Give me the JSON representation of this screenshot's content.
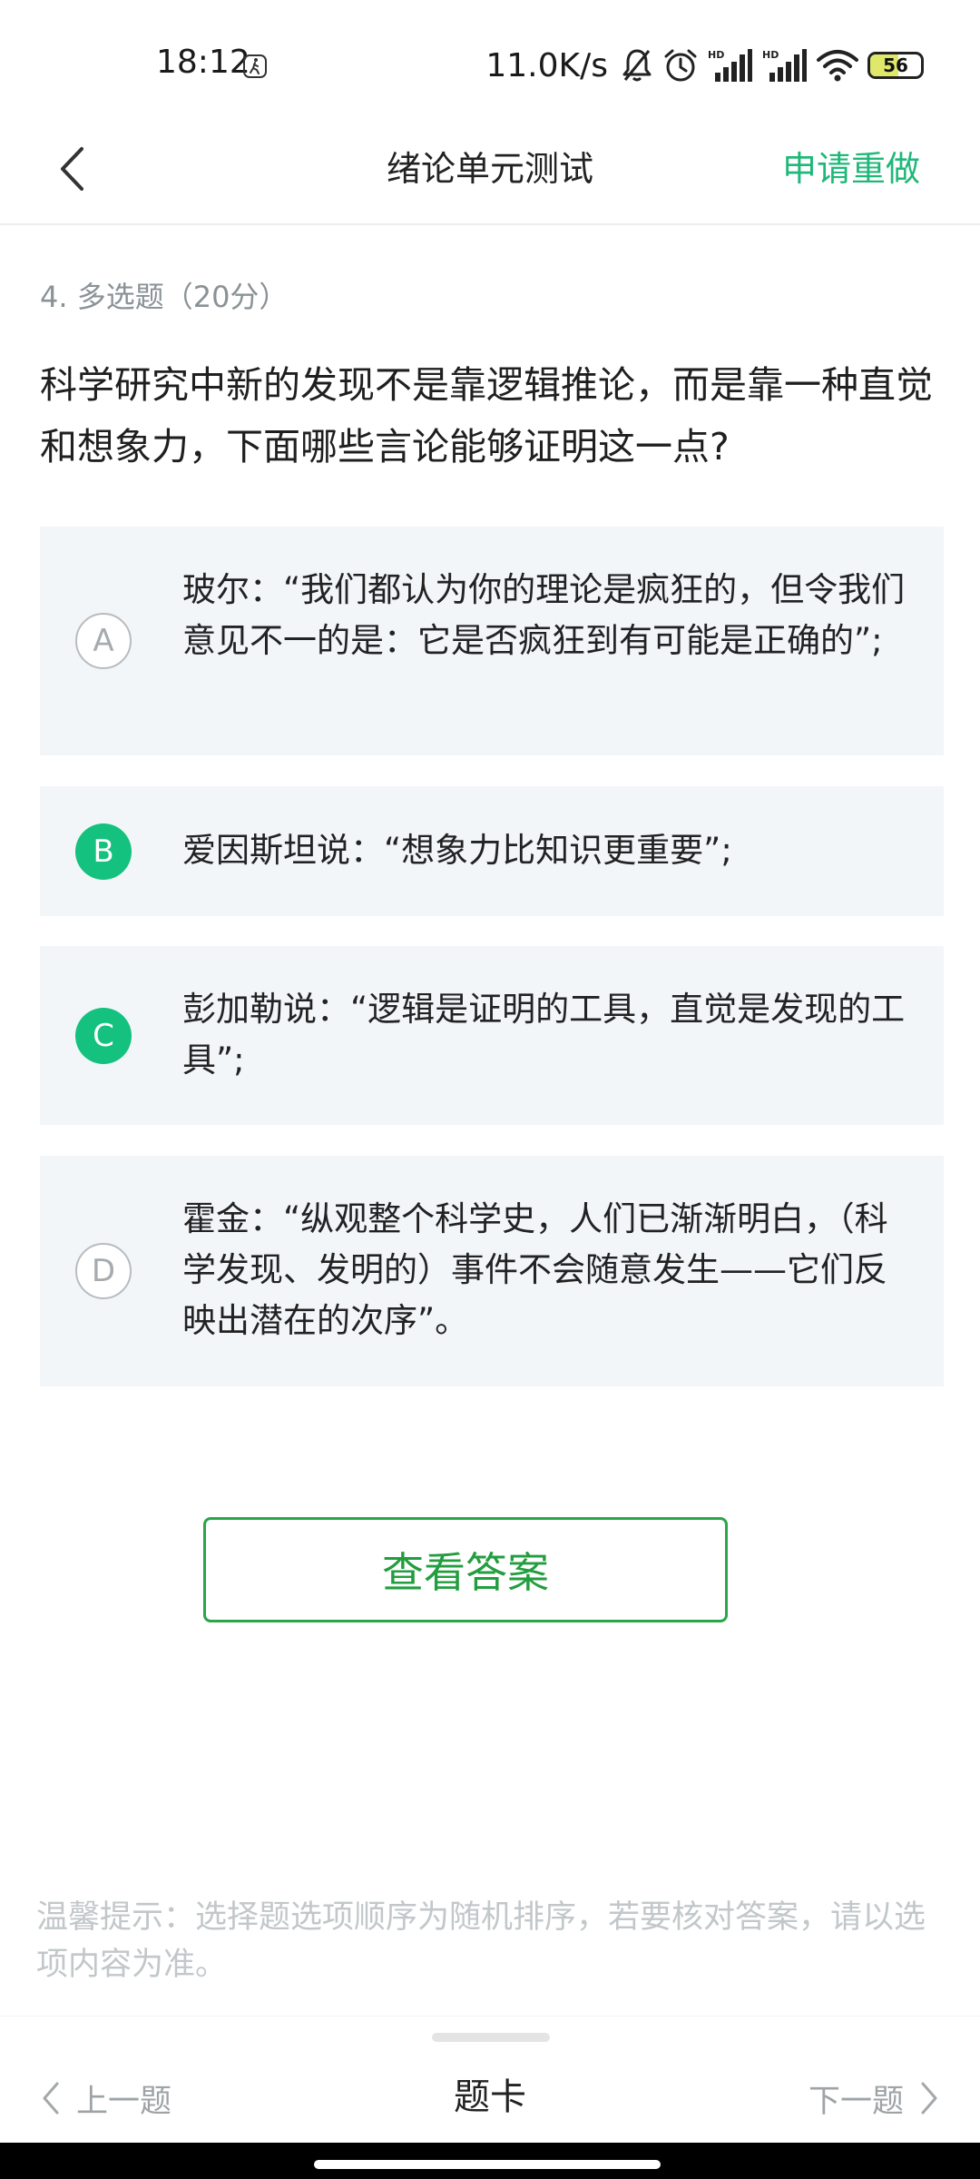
{
  "status_bar": {
    "time": "18:12",
    "network_speed": "11.0K/s",
    "battery_level": "56",
    "battery_percent": 56,
    "icons": [
      "walk-icon",
      "mute-bell-icon",
      "alarm-icon",
      "hd-signal-icon",
      "hd-signal-icon",
      "wifi-icon",
      "battery-icon"
    ],
    "hd_label": "HD"
  },
  "header": {
    "title": "绪论单元测试",
    "redo_label": "申请重做",
    "back_icon": "chevron-left-icon"
  },
  "question": {
    "meta": "4. 多选题（20分）",
    "text": "科学研究中新的发现不是靠逻辑推论，而是靠一种直觉和想象力，下面哪些言论能够证明这一点?"
  },
  "options": [
    {
      "letter": "A",
      "text": "玻尔：“我们都认为你的理论是疯狂的，但令我们意见不一的是：它是否疯狂到有可能是正确的”;",
      "selected": false
    },
    {
      "letter": "B",
      "text": "爱因斯坦说：“想象力比知识更重要”;",
      "selected": true
    },
    {
      "letter": "C",
      "text": "彭加勒说：“逻辑是证明的工具，直觉是发现的工具”;",
      "selected": true
    },
    {
      "letter": "D",
      "text": "霍金：“纵观整个科学史，人们已渐渐明白，（科学发现、发明的）事件不会随意发生——它们反映出潜在的次序”。",
      "selected": false
    }
  ],
  "answer_button": "查看答案",
  "tip": "温馨提示：选择题选项顺序为随机排序，若要核对答案，请以选项内容为准。",
  "bottom_nav": {
    "prev": "上一题",
    "card": "题卡",
    "next": "下一题"
  },
  "colors": {
    "accent": "#1fb879",
    "selected": "#15c17e",
    "answer_border": "#2aa54a",
    "option_bg": "#f2f6f9"
  }
}
